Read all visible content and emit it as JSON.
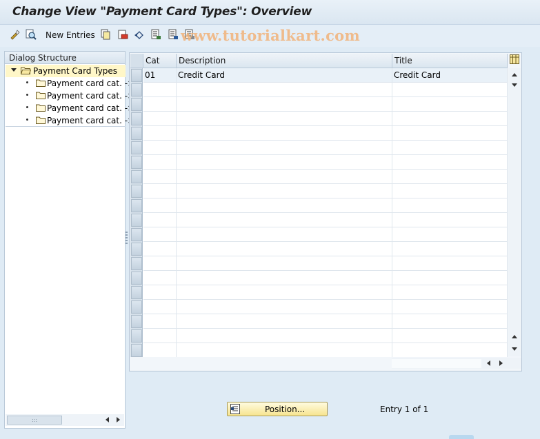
{
  "window": {
    "title": "Change View \"Payment Card Types\": Overview"
  },
  "toolbar": {
    "new_entries_label": "New Entries",
    "icons": [
      "display-change-icon",
      "find-icon",
      "copy-icon",
      "delete-icon",
      "undo-icon",
      "select-all-icon",
      "select-block-icon",
      "deselect-all-icon"
    ],
    "watermark": "www.tutorialkart.com"
  },
  "dialog_structure": {
    "header": "Dialog Structure",
    "root": {
      "label": "Payment Card Types",
      "expanded": true
    },
    "children": [
      {
        "label": "Payment card cat. ->"
      },
      {
        "label": "Payment card cat. ->"
      },
      {
        "label": "Payment card cat. ->"
      },
      {
        "label": "Payment card cat. ->"
      }
    ],
    "scroll_handle_label": ":::"
  },
  "table": {
    "columns": [
      "Cat",
      "Description",
      "Title"
    ],
    "rows": [
      {
        "cat": "01",
        "description": "Credit Card",
        "title": "Credit Card"
      }
    ],
    "empty_rows": 19
  },
  "footer": {
    "position_button_label": "Position...",
    "entry_text": "Entry 1 of 1"
  },
  "colors": {
    "background": "#dfebf5",
    "selected_node": "#fff7c8",
    "button_accent": "#f7e48f",
    "watermark": "#f2b37a"
  }
}
